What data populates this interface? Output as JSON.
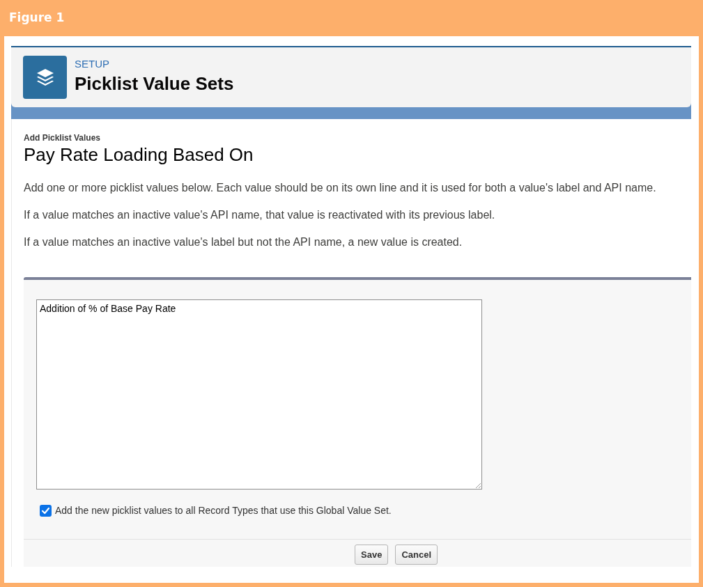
{
  "figure": {
    "title": "Figure 1"
  },
  "header": {
    "eyebrow": "SETUP",
    "title": "Picklist Value Sets"
  },
  "page": {
    "section_label": "Add Picklist Values",
    "title": "Pay Rate Loading Based On",
    "instructions": [
      "Add one or more picklist values below. Each value should be on its own line and it is used for both a value's label and API name.",
      "If a value matches an inactive value's API name, that value is reactivated with its previous label.",
      "If a value matches an inactive value's label but not the API name, a new value is created."
    ]
  },
  "form": {
    "values_field": {
      "value": "Addition of % of Base Pay Rate"
    },
    "record_types_option": {
      "label": "Add the new picklist values to all Record Types that use this Global Value Set.",
      "checked": true
    },
    "buttons": [
      "Save",
      "Cancel"
    ]
  }
}
